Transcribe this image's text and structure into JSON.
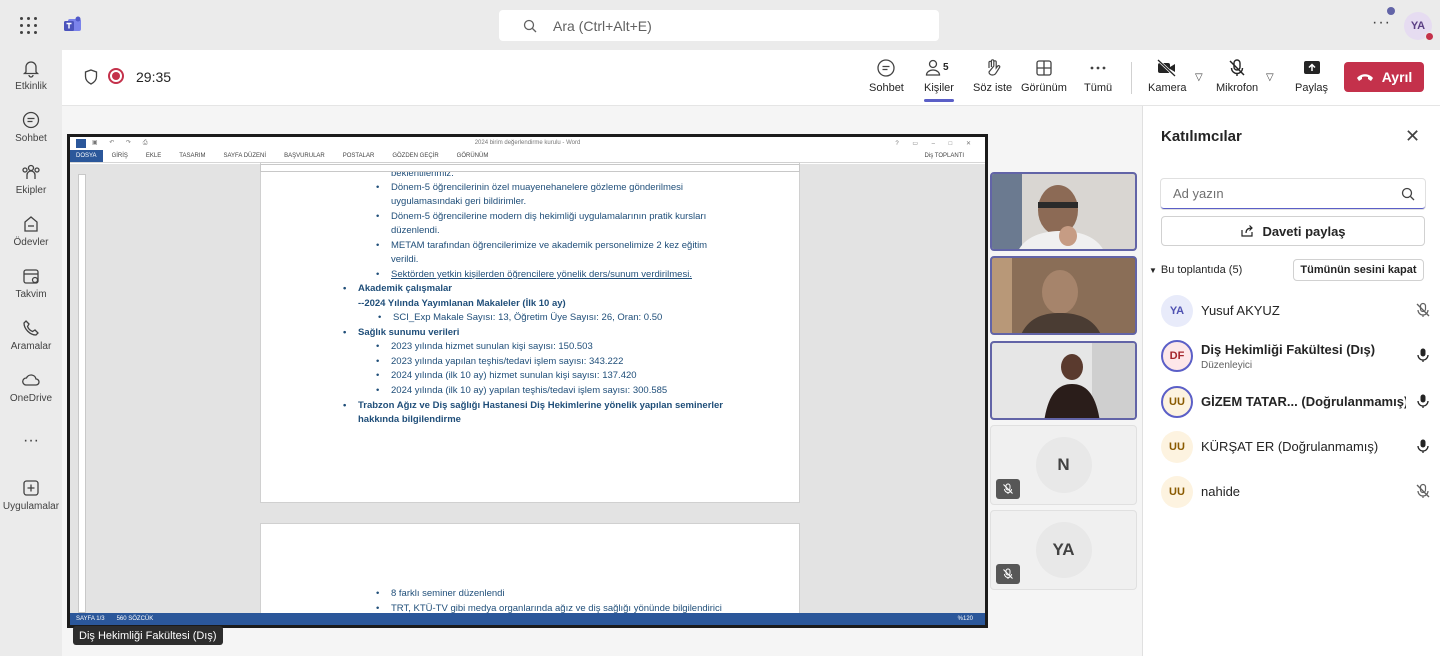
{
  "topbar": {
    "search_placeholder": "Ara (Ctrl+Alt+E)",
    "more": "···",
    "avatar_initials": "YA"
  },
  "rail": {
    "items": [
      {
        "label": "Etkinlik",
        "icon": "bell-icon"
      },
      {
        "label": "Sohbet",
        "icon": "chat-icon"
      },
      {
        "label": "Ekipler",
        "icon": "teams-icon"
      },
      {
        "label": "Ödevler",
        "icon": "assignments-icon"
      },
      {
        "label": "Takvim",
        "icon": "calendar-icon"
      },
      {
        "label": "Aramalar",
        "icon": "phone-icon"
      },
      {
        "label": "OneDrive",
        "icon": "cloud-icon"
      },
      {
        "label": "···",
        "icon": "more-icon"
      },
      {
        "label": "Uygulamalar",
        "icon": "add-apps-icon"
      }
    ]
  },
  "meeting": {
    "timer": "29:35",
    "people_count": "5",
    "buttons": {
      "chat": "Sohbet",
      "people": "Kişiler",
      "raise_hand": "Söz iste",
      "view": "Görünüm",
      "more": "Tümü",
      "camera": "Kamera",
      "mic": "Mikrofon",
      "share": "Paylaş",
      "leave": "Ayrıl"
    }
  },
  "word": {
    "title": "2024 birim değerlendirme kurulu - Word",
    "tabs": [
      "DOSYA",
      "GİRİŞ",
      "EKLE",
      "TASARIM",
      "SAYFA DÜZENİ",
      "BAŞVURULAR",
      "POSTALAR",
      "GÖZDEN GEÇİR",
      "GÖRÜNÜM"
    ],
    "user": "Diş TOPLANTI",
    "status_page": "SAYFA 1/3",
    "status_words": "560 SÖZCÜK",
    "zoom": "%120",
    "page1": [
      "beklentilerimiz.",
      "Dönem-5 öğrencilerinin özel muayenehanelere gözleme gönderilmesi",
      "uygulamasındaki geri bildirimler.",
      "Dönem-5 öğrencilerine modern diş hekimliği uygulamalarının pratik kursları",
      "düzenlendi.",
      "METAM tarafından öğrencilerimize ve akademik personelimize 2 kez eğitim",
      "verildi.",
      "Sektörden yetkin kişilerden öğrencilere yönelik ders/sunum verdirilmesi.",
      "Akademik çalışmalar",
      "--2024 Yılında Yayımlanan Makaleler (İlk 10 ay)",
      "SCI_Exp Makale Sayısı: 13, Öğretim Üye Sayısı: 26, Oran: 0.50",
      "Sağlık sunumu verileri",
      "2023 yılında hizmet sunulan kişi sayısı: 150.503",
      "2023 yılında yapılan teşhis/tedavi işlem sayısı: 343.222",
      "2024 yılında (ilk 10 ay) hizmet sunulan kişi sayısı: 137.420",
      "2024 yılında (ilk 10 ay) yapılan teşhis/tedavi işlem sayısı: 300.585",
      "Trabzon Ağız ve Diş sağlığı Hastanesi Diş Hekimlerine yönelik yapılan seminerler",
      "hakkında bilgilendirme"
    ],
    "page2": [
      "8 farklı seminer düzenlendi",
      "TRT, KTÜ-TV gibi medya organlarında ağız ve diş sağlığı yönünde bilgilendirici"
    ]
  },
  "presenter": "Diş Hekimliği Fakültesi (Dış)",
  "tiles": [
    {
      "initials": "N"
    },
    {
      "initials": "YA"
    }
  ],
  "panel": {
    "title": "Katılımcılar",
    "search_placeholder": "Ad yazın",
    "invite": "Daveti paylaş",
    "section": "Bu toplantıda (5)",
    "mute_all": "Tümünün sesini kapat",
    "participants": [
      {
        "initials": "YA",
        "name": "Yusuf AKYUZ",
        "role": "",
        "mic": "muted",
        "color": "#e8ebfa",
        "text_color": "#4f52b2"
      },
      {
        "initials": "DF",
        "name": "Diş Hekimliği Fakültesi (Dış)",
        "role": "Düzenleyici",
        "mic": "on",
        "color": "#fde7e9",
        "text_color": "#a4262c"
      },
      {
        "initials": "UU",
        "name": "GİZEM TATAR... (Doğrulanmamış)",
        "role": "",
        "mic": "on",
        "color": "#fdf3e0",
        "text_color": "#8a5a00"
      },
      {
        "initials": "UU",
        "name": "KÜRŞAT ER (Doğrulanmamış)",
        "role": "",
        "mic": "on",
        "color": "#fdf3e0",
        "text_color": "#8a5a00"
      },
      {
        "initials": "UU",
        "name": "nahide",
        "role": "",
        "mic": "muted",
        "color": "#fdf3e0",
        "text_color": "#8a5a00"
      }
    ]
  },
  "colors": {
    "accent": "#5b5fc7",
    "leave": "#c4314b",
    "word_blue": "#2b579a",
    "doc_text": "#1f4e79"
  }
}
